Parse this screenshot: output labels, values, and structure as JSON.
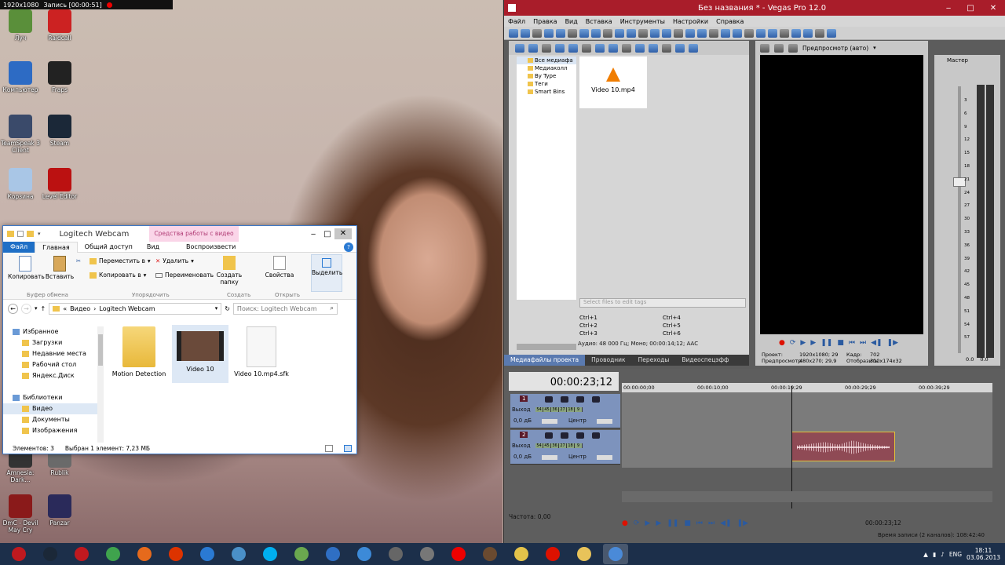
{
  "recorder": {
    "resolution": "1920x1080",
    "record_label": "Запись [00:00:51]"
  },
  "desktop": {
    "icons": [
      {
        "label": "Луч",
        "color": "#5a8f3a"
      },
      {
        "label": "Raidcall",
        "color": "#c22"
      },
      {
        "label": "Компьютер",
        "color": "#2d6bc4"
      },
      {
        "label": "Fraps",
        "color": "#222"
      },
      {
        "label": "TeamSpeak 3 Client",
        "color": "#3a4a6a"
      },
      {
        "label": "Steam",
        "color": "#1b2838"
      },
      {
        "label": "Корзина",
        "color": "#a9c6e6"
      },
      {
        "label": "Level Editor",
        "color": "#b11"
      },
      {
        "label": "Amnesia: Dark...",
        "color": "#333"
      },
      {
        "label": "Rublik",
        "color": "#6a6a6a"
      },
      {
        "label": "DmC - Devil May Cry",
        "color": "#8a1a1a"
      },
      {
        "label": "Panzar",
        "color": "#2a2a5a"
      }
    ]
  },
  "explorer": {
    "title": "Logitech Webcam",
    "contextual_tab": "Средства работы с видео",
    "tabs": [
      "Файл",
      "Главная",
      "Общий доступ",
      "Вид",
      "Воспроизвести"
    ],
    "ribbon": {
      "copy": "Копировать",
      "paste": "Вставить",
      "move_to": "Переместить в",
      "copy_to": "Копировать в",
      "delete": "Удалить",
      "rename": "Переименовать",
      "new_folder": "Создать папку",
      "properties": "Свойства",
      "select": "Выделить",
      "groups": [
        "Буфер обмена",
        "Упорядочить",
        "Создать",
        "Открыть"
      ]
    },
    "address": {
      "crumbs": [
        "Видео",
        "Logitech Webcam"
      ],
      "search_placeholder": "Поиск: Logitech Webcam"
    },
    "nav": [
      {
        "label": "Избранное",
        "indent": 0
      },
      {
        "label": "Загрузки",
        "indent": 1
      },
      {
        "label": "Недавние места",
        "indent": 1
      },
      {
        "label": "Рабочий стол",
        "indent": 1
      },
      {
        "label": "Яндекс.Диск",
        "indent": 1
      },
      {
        "label": "",
        "indent": 0
      },
      {
        "label": "Библиотеки",
        "indent": 0
      },
      {
        "label": "Видео",
        "indent": 1,
        "selected": true
      },
      {
        "label": "Документы",
        "indent": 1
      },
      {
        "label": "Изображения",
        "indent": 1
      }
    ],
    "files": [
      "Motion Detection",
      "Video 10",
      "Video 10.mp4.sfk"
    ],
    "status": {
      "count": "Элементов: 3",
      "selection": "Выбран 1 элемент: 7,23 МБ"
    }
  },
  "vegas": {
    "title": "Без названия * - Vegas Pro 12.0",
    "menu": [
      "Файл",
      "Правка",
      "Вид",
      "Вставка",
      "Инструменты",
      "Настройки",
      "Справка"
    ],
    "media_tree": [
      "Все медиафа",
      "Медиаколл",
      "By Type",
      "Теги",
      "Smart Bins"
    ],
    "media_file": "Video 10.mp4",
    "tag_placeholder": "Select files to edit tags",
    "shortcuts": [
      [
        "Ctrl+1",
        "Ctrl+4"
      ],
      [
        "Ctrl+2",
        "Ctrl+5"
      ],
      [
        "Ctrl+3",
        "Ctrl+6"
      ]
    ],
    "audio_info": "Аудио: 48 000 Гц; Моно; 00:00:14;12; AAC",
    "tabs": [
      "Медиафайлы проекта",
      "Проводник",
      "Переходы",
      "Видеоспецэфф"
    ],
    "preview_mode": "Предпросмотр (авто)",
    "preview_info": {
      "project_label": "Проект:",
      "project_value": "1920x1080; 29",
      "preview_label": "Предпросмотр:",
      "preview_value": "480x270; 29,9",
      "frame_label": "Кадр:",
      "frame_value": "702",
      "display_label": "Отобразить:",
      "display_value": "310x174x32"
    },
    "master_label": "Мастер",
    "meter_ticks": [
      "3",
      "6",
      "9",
      "12",
      "15",
      "18",
      "21",
      "24",
      "27",
      "30",
      "33",
      "36",
      "39",
      "42",
      "45",
      "48",
      "51",
      "54",
      "57"
    ],
    "master_values": [
      "0.0",
      "0.0"
    ],
    "timecode": "00:00:23;12",
    "ruler": [
      "00:00:00;00",
      "00:00:10;00",
      "00:00:19;29",
      "00:00:29;29",
      "00:00:39;29"
    ],
    "tracks": [
      {
        "num": "1",
        "out_label": "Выход",
        "gain": "0,0 дБ",
        "pan": "Центр",
        "vu": [
          "54",
          "45",
          "36",
          "27",
          "18",
          "9"
        ]
      },
      {
        "num": "2",
        "out_label": "Выход",
        "gain": "0,0 дБ",
        "pan": "Центр",
        "vu": [
          "54",
          "45",
          "36",
          "27",
          "18",
          "9"
        ]
      }
    ],
    "rate": "Частота: 0,00",
    "bottom_timecode": "00:00:23;12",
    "record_time": "Время записи (2 каналов): 108:42:40"
  },
  "taskbar": {
    "apps": [
      {
        "name": "app-red-icon",
        "color": "#c0191f"
      },
      {
        "name": "steam-icon",
        "color": "#1b2838"
      },
      {
        "name": "opera-icon",
        "color": "#c0191f"
      },
      {
        "name": "chrome-icon",
        "color": "#3fa34d"
      },
      {
        "name": "firefox-icon",
        "color": "#e66a1c"
      },
      {
        "name": "opera-red-icon",
        "color": "#d30"
      },
      {
        "name": "ie-icon",
        "color": "#2a7ad3"
      },
      {
        "name": "network-icon",
        "color": "#4a90c8"
      },
      {
        "name": "skype-icon",
        "color": "#00aff0"
      },
      {
        "name": "utorrent-icon",
        "color": "#6aa84f"
      },
      {
        "name": "mail-icon",
        "color": "#2f6fc4"
      },
      {
        "name": "globe-icon",
        "color": "#3c8ad8"
      },
      {
        "name": "wot-icon",
        "color": "#666"
      },
      {
        "name": "fraps-icon",
        "color": "#777"
      },
      {
        "name": "yandex-icon",
        "color": "#e00"
      },
      {
        "name": "game-icon",
        "color": "#6a4a30"
      },
      {
        "name": "bean-icon",
        "color": "#e3c34a"
      },
      {
        "name": "record-icon",
        "color": "#d10"
      },
      {
        "name": "explorer-icon",
        "color": "#e8c35a"
      },
      {
        "name": "vegas-icon",
        "color": "#4a8ad8"
      }
    ],
    "lang": "ENG",
    "time": "18:11",
    "date": "03.06.2013"
  }
}
